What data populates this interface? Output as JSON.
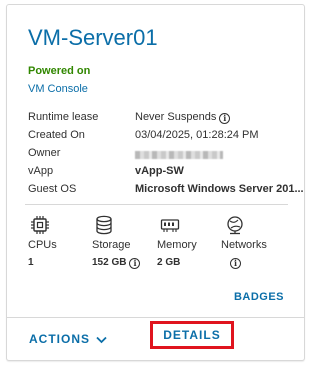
{
  "vm": {
    "name": "VM-Server01",
    "status": "Powered on",
    "console_link": "VM Console"
  },
  "properties": [
    {
      "label": "Runtime lease",
      "value": "Never Suspends",
      "info": true,
      "bold": false
    },
    {
      "label": "Created On",
      "value": "03/04/2025, 01:28:24 PM",
      "info": false,
      "bold": false
    },
    {
      "label": "Owner",
      "value": "",
      "redacted": true,
      "info": false,
      "bold": false
    },
    {
      "label": "vApp",
      "value": "vApp-SW",
      "info": false,
      "bold": true
    },
    {
      "label": "Guest OS",
      "value": "Microsoft Windows Server 201...",
      "info": false,
      "bold": true
    }
  ],
  "resources": {
    "cpus": {
      "label": "CPUs",
      "value": "1",
      "icon": "cpu-icon"
    },
    "storage": {
      "label": "Storage",
      "value": "152 GB",
      "icon": "storage-icon"
    },
    "memory": {
      "label": "Memory",
      "value": "2 GB",
      "icon": "memory-icon"
    },
    "networks": {
      "label": "Networks",
      "value": "",
      "icon": "network-icon"
    }
  },
  "badges_label": "BADGES",
  "actions_label": "ACTIONS",
  "details_label": "DETAILS",
  "colors": {
    "link": "#0b6ea8",
    "status_on": "#318700",
    "highlight": "#e0141e"
  }
}
